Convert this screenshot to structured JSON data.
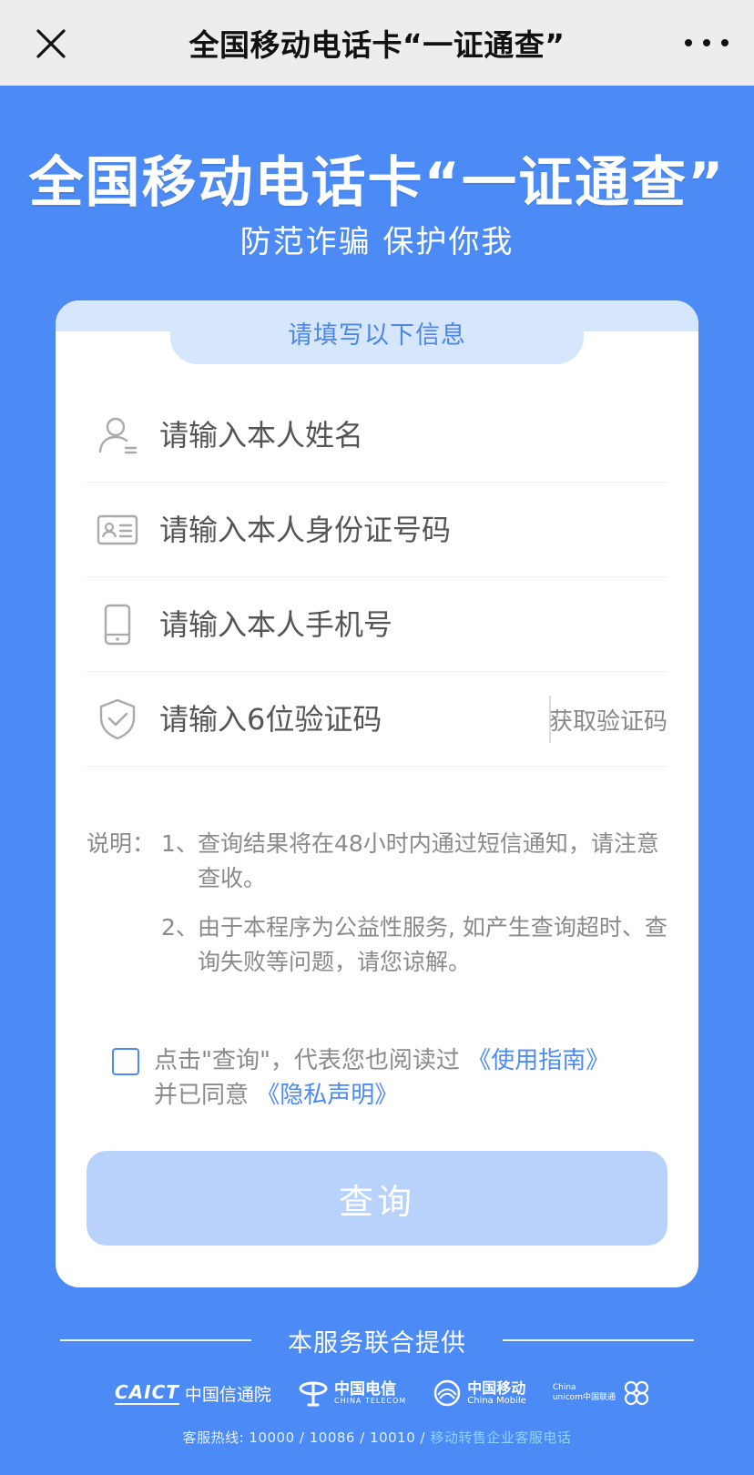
{
  "topbar": {
    "title": "全国移动电话卡“一证通查”"
  },
  "hero": {
    "title": "全国移动电话卡“一证通查”",
    "subtitle": "防范诈骗 保护你我"
  },
  "card": {
    "tab_label": "请填写以下信息",
    "fields": {
      "name_placeholder": "请输入本人姓名",
      "id_placeholder": "请输入本人身份证号码",
      "phone_placeholder": "请输入本人手机号",
      "code_placeholder": "请输入6位验证码",
      "get_code_label": "获取验证码"
    },
    "notes": {
      "label": "说明：",
      "item1_num": "1、",
      "item1_text": "查询结果将在48小时内通过短信通知，请注意查收。",
      "item2_num": "2、",
      "item2_text": "由于本程序为公益性服务, 如产生查询超时、查询失败等问题，请您谅解。"
    },
    "agreement": {
      "prefix": "点击\"查询\"，代表您也阅读过",
      "guide_link": "《使用指南》",
      "middle": "并已同意",
      "privacy_link": "《隐私声明》"
    },
    "query_button": "查询"
  },
  "footer": {
    "provider_text": "本服务联合提供",
    "logos": {
      "caict_mark": "CAICT",
      "caict_name": "中国信通院",
      "telecom_name": "中国电信",
      "telecom_sub": "CHINA TELECOM",
      "mobile_name": "中国移动",
      "mobile_sub": "China Mobile",
      "unicom_name1": "China",
      "unicom_name2": "unicom中国联通"
    },
    "hotline_text": "客服热线: 10000 / 10086 / 10010 /",
    "hotline_link": "移动转售企业客服电话"
  },
  "colors": {
    "page_bg": "#4c8bf5",
    "accent": "#4c8bf5",
    "tab_bg": "#d6e6fd",
    "button_disabled": "#b9d2fb"
  }
}
